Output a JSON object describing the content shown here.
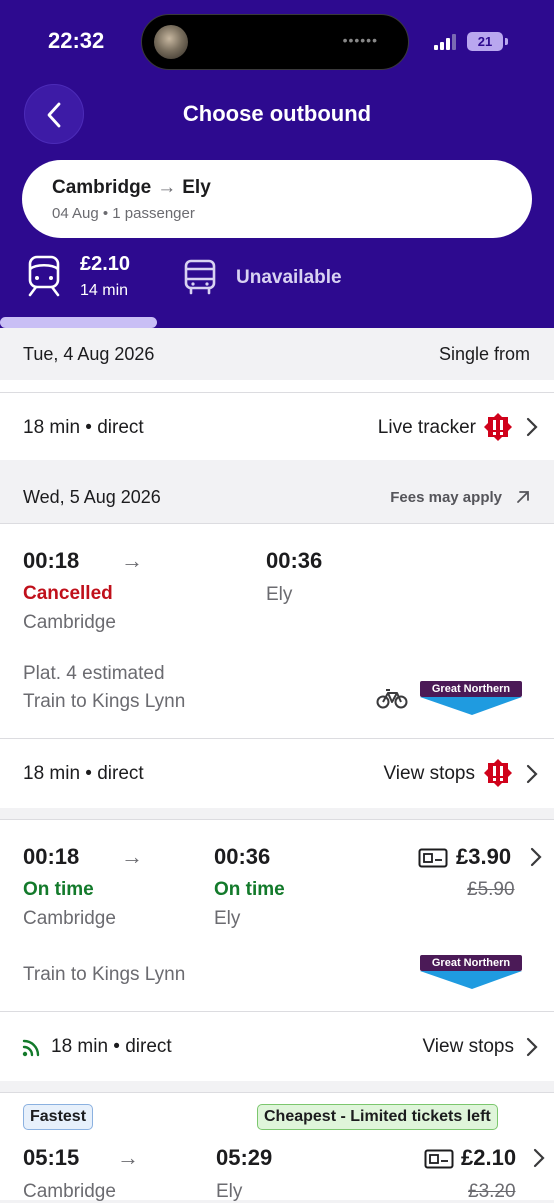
{
  "status_bar": {
    "time": "22:32",
    "battery": "21"
  },
  "header": {
    "title": "Choose outbound",
    "route_from": "Cambridge",
    "route_to": "Ely",
    "route_sub": "04 Aug • 1 passenger",
    "train_mode": {
      "price": "£2.10",
      "duration": "14 min"
    },
    "bus_mode": {
      "label": "Unavailable"
    }
  },
  "sections": [
    {
      "date": "Tue, 4 Aug 2026",
      "right": "Single from"
    },
    {
      "date": "Wed, 5 Aug 2026",
      "right": "Fees may apply"
    }
  ],
  "summary_row_1": {
    "text": "18 min • direct",
    "action": "Live tracker"
  },
  "journey_1": {
    "depart": "00:18",
    "arrive": "00:36",
    "depart_status": "Cancelled",
    "depart_station": "Cambridge",
    "arrive_station": "Ely",
    "platform": "Plat. 4 estimated",
    "train": "Train to Kings Lynn",
    "operator": "Great Northern",
    "summary": "18 min • direct",
    "action": "View stops"
  },
  "journey_2": {
    "depart": "00:18",
    "arrive": "00:36",
    "depart_status": "On time",
    "arrive_status": "On time",
    "depart_station": "Cambridge",
    "arrive_station": "Ely",
    "price": "£3.90",
    "old_price": "£5.90",
    "train": "Train to Kings Lynn",
    "operator": "Great Northern",
    "summary": "18 min • direct",
    "action": "View stops"
  },
  "journey_3": {
    "badge_fastest": "Fastest",
    "badge_cheapest": "Cheapest - Limited tickets left",
    "depart": "05:15",
    "arrive": "05:29",
    "depart_station": "Cambridge",
    "arrive_station": "Ely",
    "price": "£2.10",
    "old_price": "£3.20"
  },
  "colors": {
    "brand": "#2d0a8f",
    "cancelled": "#c0101b",
    "on_time": "#137a2b",
    "warning": "#d0021b"
  }
}
